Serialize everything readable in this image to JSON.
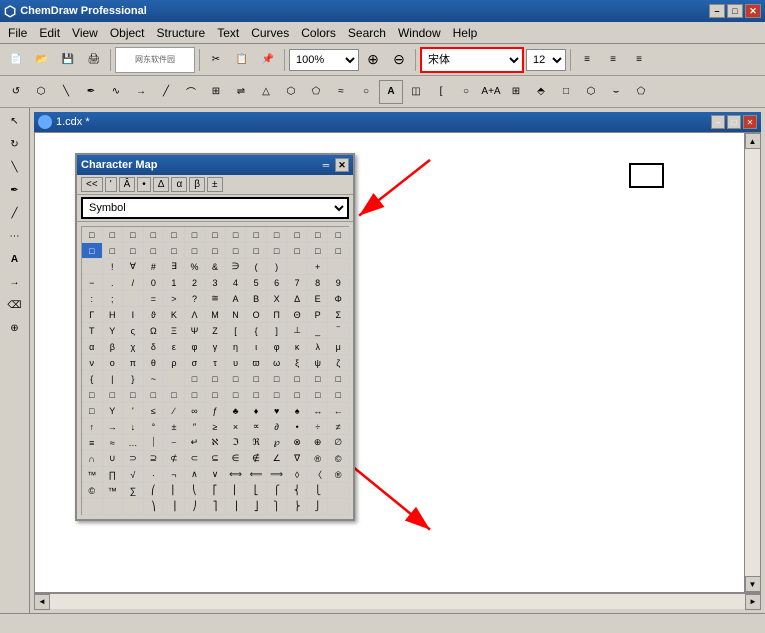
{
  "app": {
    "title": "ChemDraw Professional",
    "icon": "◉"
  },
  "title_bar": {
    "title": "ChemDraw Professional",
    "minimize": "–",
    "maximize": "□",
    "close": "✕"
  },
  "menu": {
    "items": [
      "File",
      "Edit",
      "View",
      "Object",
      "Structure",
      "Text",
      "Curves",
      "Colors",
      "Search",
      "Window",
      "Help"
    ]
  },
  "toolbar1": {
    "zoom_value": "100%",
    "font_name": "宋体",
    "font_size": "12",
    "align_left": "≡",
    "align_center": "≡",
    "align_right": "≡"
  },
  "document": {
    "title": "1.cdx *",
    "minimize": "–",
    "maximize": "□",
    "close": "✕"
  },
  "char_map": {
    "title": "Character Map",
    "toolbar_buttons": [
      "<<",
      "'",
      "Â",
      "•",
      "Δ",
      "α",
      "β",
      "±"
    ],
    "font_label": "Symbol",
    "symbols": [
      "□",
      "□",
      "□",
      "□",
      "□",
      "□",
      "□",
      "□",
      "□",
      "□",
      "□",
      "□",
      "□",
      "□",
      "□",
      "□",
      "□",
      "□",
      "□",
      "□",
      "□",
      "□",
      "□",
      "□",
      "□",
      "□",
      " ",
      "!",
      "∀",
      "#",
      "∃",
      "%",
      "&",
      "∋",
      "(",
      ")",
      " ",
      "+",
      " ",
      "−",
      ".",
      "/",
      "0",
      "1",
      "2",
      "3",
      "4",
      "5",
      "6",
      "7",
      "8",
      "9",
      ":",
      ";",
      " ",
      "=",
      ">",
      "?",
      "≅",
      "Α",
      "Β",
      "Χ",
      "Δ",
      "Ε",
      "Φ",
      "Γ",
      "Η",
      "Ι",
      "ϑ",
      "Κ",
      "Λ",
      "Μ",
      "Ν",
      "Ο",
      "Π",
      "Θ",
      "Ρ",
      "Σ",
      "Τ",
      "Υ",
      "ς",
      "Ω",
      "Ξ",
      "Ψ",
      "Ζ",
      "[",
      "{",
      "]",
      "⊥",
      "_",
      "‾",
      "α",
      "β",
      "χ",
      "δ",
      "ε",
      "φ",
      "γ",
      "η",
      "ι",
      "φ",
      "κ",
      "λ",
      "μ",
      "ν",
      "ο",
      "π",
      "θ",
      "ρ",
      "σ",
      "τ",
      "υ",
      "ϖ",
      "ω",
      "ξ",
      "ψ",
      "ζ",
      "{",
      "|",
      "}",
      "~",
      " ",
      "□",
      "□",
      "□",
      "□",
      "□",
      "□",
      "□",
      "□",
      "□",
      "□",
      "□",
      "□",
      "□",
      "□",
      "□",
      "□",
      "□",
      "□",
      "□",
      "□",
      "□",
      "□",
      "Υ",
      "'",
      "≤",
      "∕",
      "∞",
      "ƒ",
      "♣",
      "♦",
      "♥",
      "♠",
      "↔",
      "←",
      "↑",
      "→",
      "↓",
      "°",
      "±",
      "″",
      "≥",
      "×",
      "∝",
      "∂",
      "•",
      "÷",
      "≠",
      "≡",
      "≈",
      "…",
      "⏐",
      "⎯",
      "↵",
      "ℵ",
      "ℑ",
      "ℜ",
      "℘",
      "⊗",
      "⊕",
      "∅",
      "∩",
      "∪",
      "⊃",
      "⊇",
      "⊄",
      "⊂",
      "⊆",
      "∈",
      "∉",
      "∠",
      "∇",
      "®",
      "©",
      "™",
      "∏",
      "√",
      "·",
      "¬",
      "∧",
      "∨",
      "⟺",
      "⟸",
      "⟹",
      "◊",
      "〈",
      "®",
      "©",
      "™",
      "∑",
      "⎛",
      "⎜",
      "⎝",
      "⎡",
      "⎢",
      "⎣",
      "⎧",
      "⎨",
      "⎩",
      " ",
      " ",
      " ",
      " ",
      "⎞",
      "⎟",
      "⎠",
      "⎤",
      "⎥",
      "⎦",
      "⎫",
      "⎬",
      "⎭",
      " "
    ]
  },
  "status_bar": {
    "text": ""
  }
}
